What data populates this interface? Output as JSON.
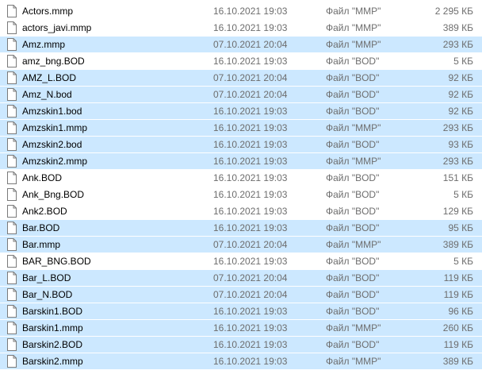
{
  "files": [
    {
      "name": "Actors.mmp",
      "date": "16.10.2021 19:03",
      "type": "Файл \"MMP\"",
      "size": "2 295 КБ",
      "selected": false
    },
    {
      "name": "actors_javi.mmp",
      "date": "16.10.2021 19:03",
      "type": "Файл \"MMP\"",
      "size": "389 КБ",
      "selected": false
    },
    {
      "name": "Amz.mmp",
      "date": "07.10.2021 20:04",
      "type": "Файл \"MMP\"",
      "size": "293 КБ",
      "selected": true
    },
    {
      "name": "amz_bng.BOD",
      "date": "16.10.2021 19:03",
      "type": "Файл \"BOD\"",
      "size": "5 КБ",
      "selected": false
    },
    {
      "name": "AMZ_L.BOD",
      "date": "07.10.2021 20:04",
      "type": "Файл \"BOD\"",
      "size": "92 КБ",
      "selected": true
    },
    {
      "name": "Amz_N.bod",
      "date": "07.10.2021 20:04",
      "type": "Файл \"BOD\"",
      "size": "92 КБ",
      "selected": true
    },
    {
      "name": "Amzskin1.bod",
      "date": "16.10.2021 19:03",
      "type": "Файл \"BOD\"",
      "size": "92 КБ",
      "selected": true
    },
    {
      "name": "Amzskin1.mmp",
      "date": "16.10.2021 19:03",
      "type": "Файл \"MMP\"",
      "size": "293 КБ",
      "selected": true
    },
    {
      "name": "Amzskin2.bod",
      "date": "16.10.2021 19:03",
      "type": "Файл \"BOD\"",
      "size": "93 КБ",
      "selected": true
    },
    {
      "name": "Amzskin2.mmp",
      "date": "16.10.2021 19:03",
      "type": "Файл \"MMP\"",
      "size": "293 КБ",
      "selected": true
    },
    {
      "name": "Ank.BOD",
      "date": "16.10.2021 19:03",
      "type": "Файл \"BOD\"",
      "size": "151 КБ",
      "selected": false
    },
    {
      "name": "Ank_Bng.BOD",
      "date": "16.10.2021 19:03",
      "type": "Файл \"BOD\"",
      "size": "5 КБ",
      "selected": false
    },
    {
      "name": "Ank2.BOD",
      "date": "16.10.2021 19:03",
      "type": "Файл \"BOD\"",
      "size": "129 КБ",
      "selected": false
    },
    {
      "name": "Bar.BOD",
      "date": "16.10.2021 19:03",
      "type": "Файл \"BOD\"",
      "size": "95 КБ",
      "selected": true
    },
    {
      "name": "Bar.mmp",
      "date": "07.10.2021 20:04",
      "type": "Файл \"MMP\"",
      "size": "389 КБ",
      "selected": true
    },
    {
      "name": "BAR_BNG.BOD",
      "date": "16.10.2021 19:03",
      "type": "Файл \"BOD\"",
      "size": "5 КБ",
      "selected": false
    },
    {
      "name": "Bar_L.BOD",
      "date": "07.10.2021 20:04",
      "type": "Файл \"BOD\"",
      "size": "119 КБ",
      "selected": true
    },
    {
      "name": "Bar_N.BOD",
      "date": "07.10.2021 20:04",
      "type": "Файл \"BOD\"",
      "size": "119 КБ",
      "selected": true
    },
    {
      "name": "Barskin1.BOD",
      "date": "16.10.2021 19:03",
      "type": "Файл \"BOD\"",
      "size": "96 КБ",
      "selected": true
    },
    {
      "name": "Barskin1.mmp",
      "date": "16.10.2021 19:03",
      "type": "Файл \"MMP\"",
      "size": "260 КБ",
      "selected": true
    },
    {
      "name": "Barskin2.BOD",
      "date": "16.10.2021 19:03",
      "type": "Файл \"BOD\"",
      "size": "119 КБ",
      "selected": true
    },
    {
      "name": "Barskin2.mmp",
      "date": "16.10.2021 19:03",
      "type": "Файл \"MMP\"",
      "size": "389 КБ",
      "selected": true
    }
  ],
  "icon": "blank-file-icon",
  "colors": {
    "selection": "#cce8ff",
    "secondary_text": "#6d6d6d"
  }
}
